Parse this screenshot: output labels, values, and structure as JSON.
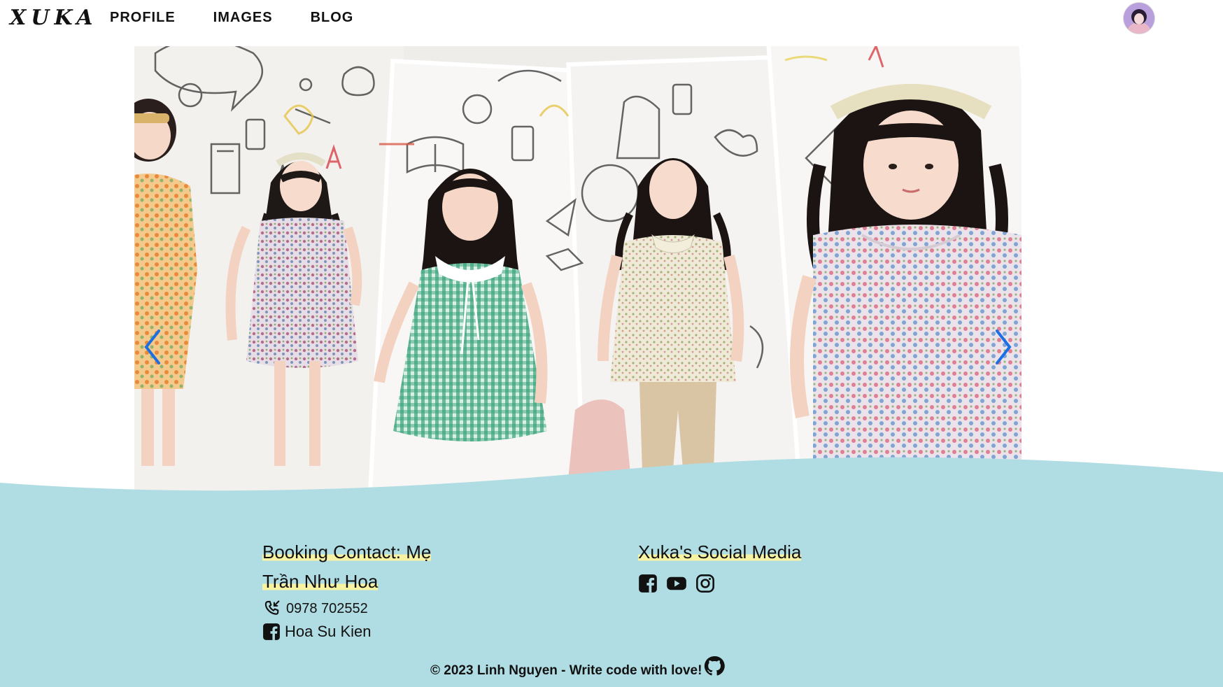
{
  "header": {
    "logo": "XUKA",
    "nav": [
      "PROFILE",
      "IMAGES",
      "BLOG"
    ]
  },
  "carousel": {
    "prev_icon": "chevron-left-icon",
    "next_icon": "chevron-right-icon",
    "accent": "#1b6fe3"
  },
  "footer": {
    "bg_color": "#b0dde3",
    "highlight_color": "#f7f3a3",
    "contact": {
      "title_line1": "Booking Contact: Mẹ",
      "title_line2": "Trần Như Hoa",
      "phone": "0978 702552",
      "facebook_name": "Hoa Su Kien"
    },
    "social": {
      "title": "Xuka's Social Media",
      "icons": [
        "facebook-icon",
        "youtube-icon",
        "instagram-icon"
      ]
    },
    "copyright": "© 2023 Linh Nguyen - Write code with love!"
  }
}
